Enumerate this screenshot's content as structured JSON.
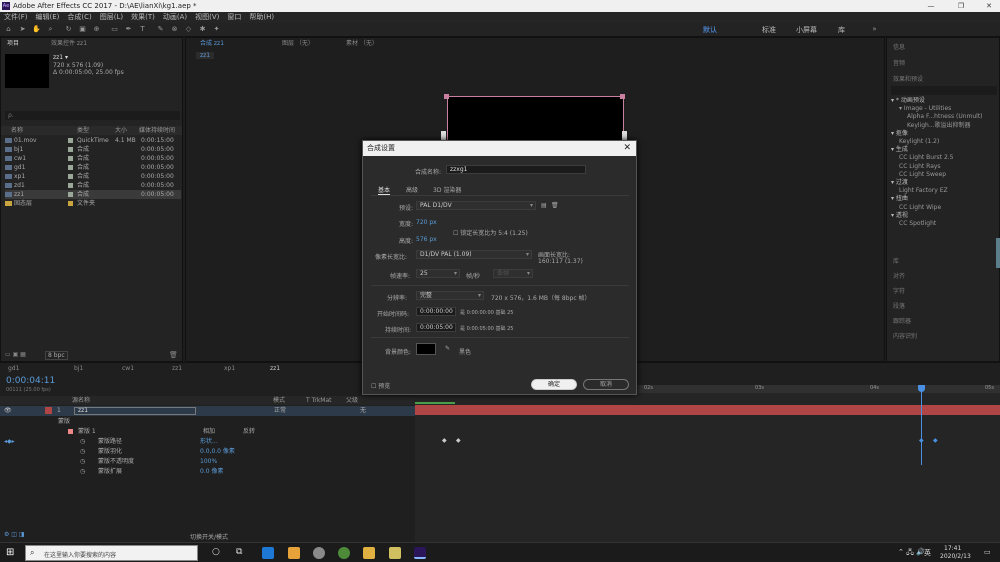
{
  "app": {
    "window_title": "Adobe After Effects CC 2017 - D:\\AE\\lianXi\\kg1.aep *",
    "logo_text": "Ae",
    "win_minimize": "—",
    "win_restore": "❐",
    "win_close": "✕"
  },
  "menu": [
    "文件(F)",
    "编辑(E)",
    "合成(C)",
    "图层(L)",
    "效果(T)",
    "动画(A)",
    "视图(V)",
    "窗口",
    "帮助(H)"
  ],
  "workspaces": [
    "默认",
    "标准",
    "小屏幕",
    "库"
  ],
  "project_panel": {
    "tab_label": "项目",
    "effect_controls_tab": "效果控件 zz1",
    "comp_name": "zz1 ▾",
    "comp_dims": "720 x 576 (1.09)",
    "comp_duration": "Δ 0:00:05:00, 25.00 fps",
    "search_placeholder": "ρ.",
    "columns": {
      "name": "名称",
      "type": "类型",
      "size": "大小",
      "duration": "媒体持续时间"
    },
    "files": [
      {
        "name": "01.mov",
        "type": "QuickTime",
        "size": "4.1 MB",
        "duration": "0:00:15:00"
      },
      {
        "name": "bj1",
        "type": "合成",
        "size": "",
        "duration": "0:00:05:00"
      },
      {
        "name": "cw1",
        "type": "合成",
        "size": "",
        "duration": "0:00:05:00"
      },
      {
        "name": "gd1",
        "type": "合成",
        "size": "",
        "duration": "0:00:05:00"
      },
      {
        "name": "xp1",
        "type": "合成",
        "size": "",
        "duration": "0:00:05:00"
      },
      {
        "name": "zd1",
        "type": "合成",
        "size": "",
        "duration": "0:00:05:00"
      },
      {
        "name": "zz1",
        "type": "合成",
        "size": "",
        "duration": "0:00:05:00"
      },
      {
        "name": "固态层",
        "type": "文件夹",
        "size": "",
        "duration": ""
      }
    ],
    "bpc": "8 bpc"
  },
  "viewer": {
    "tabs": [
      "合成 zz1",
      "图层 （无）",
      "素材 （无）"
    ],
    "comp_tab": "zz1"
  },
  "effects_panel": {
    "tabs": [
      "信息",
      "音频",
      "效果和预设"
    ],
    "tree": [
      {
        "label": "▾ * 动画预设",
        "level": 0
      },
      {
        "label": "▾ Image - Utilities",
        "level": 1
      },
      {
        "label": "Alpha F...htness (Unmult)",
        "level": 2
      },
      {
        "label": "Keyligh...歌溢出抑制器",
        "level": 2
      },
      {
        "label": "▾ 抠像",
        "level": 0
      },
      {
        "label": "Keylight (1.2)",
        "level": 1
      },
      {
        "label": "▾ 生成",
        "level": 0
      },
      {
        "label": "CC Light Burst 2.5",
        "level": 1
      },
      {
        "label": "CC Light Rays",
        "level": 1
      },
      {
        "label": "CC Light Sweep",
        "level": 1
      },
      {
        "label": "▾ 过渡",
        "level": 0
      },
      {
        "label": "Light Factory EZ",
        "level": 1
      },
      {
        "label": "▾ 扭曲",
        "level": 0
      },
      {
        "label": "CC Light Wipe",
        "level": 1
      },
      {
        "label": "▾ 透视",
        "level": 0
      },
      {
        "label": "CC Spotlight",
        "level": 1
      }
    ],
    "lower": [
      "库",
      "对齐",
      "字符",
      "段落",
      "跟踪器",
      "内容识别"
    ]
  },
  "timeline": {
    "tabs": [
      "gd1",
      "bj1",
      "cw1",
      "zz1",
      "xp1",
      "zz1"
    ],
    "timecode": "0:00:04:11",
    "timecode_sub": "00111 (25.00 fps)",
    "col_source": "源名称",
    "col_mode": "模式",
    "col_trkmat": "T TrkMat",
    "col_parent": "父级",
    "layer_num": "1",
    "layer_name": "zz1",
    "mode_value": "正常",
    "parent_value": "无",
    "mask_group": "蒙版",
    "mask_name": "蒙版 1",
    "mask_mode": "相加",
    "mask_invert": "反转",
    "props": [
      {
        "name": "蒙版路径",
        "value": "形状..."
      },
      {
        "name": "蒙版羽化",
        "value": "0.0,0.0 像素"
      },
      {
        "name": "蒙版不透明度",
        "value": "100%"
      },
      {
        "name": "蒙版扩展",
        "value": "0.0 像素"
      }
    ],
    "ruler": [
      "02s",
      "03s",
      "04s",
      "05s"
    ],
    "bottom_toggle": "切换开关/模式"
  },
  "dialog": {
    "title": "合成设置",
    "close": "✕",
    "name_label": "合成名称:",
    "name_value": "zzxg1",
    "tabs": [
      "基本",
      "高级",
      "3D 渲染器"
    ],
    "preset_label": "预设:",
    "preset_value": "PAL D1/DV",
    "width_label": "宽度:",
    "width_value": "720 px",
    "height_label": "高度:",
    "height_value": "576 px",
    "lock_label": "锁定长宽比为 5:4 (1.25)",
    "par_label": "像素长宽比:",
    "par_value": "D1/DV PAL (1.09)",
    "frame_aspect_label": "画面长宽比:",
    "frame_aspect_value": "160:117 (1.37)",
    "fps_label": "帧速率:",
    "fps_value": "25",
    "fps_unit": "帧/秒",
    "fps_drop": "丢帧",
    "res_label": "分辨率:",
    "res_value": "完整",
    "res_info": "720 x 576，1.6 MB（每 8bpc 帧）",
    "start_label": "开始时间码:",
    "start_value": "0:00:00:00",
    "start_info": "是 0:00:00:00  基础 25",
    "dur_label": "持续时间:",
    "dur_value": "0:00:05:00",
    "dur_info": "是 0:00:05:00  基础 25",
    "bg_label": "背景颜色:",
    "bg_name": "黑色",
    "preview_label": "预览",
    "ok": "确定",
    "cancel": "取消"
  },
  "taskbar": {
    "search_placeholder": "在这里输入你要搜索的内容",
    "time": "17:41",
    "date": "2020/2/13",
    "ime": "英"
  }
}
